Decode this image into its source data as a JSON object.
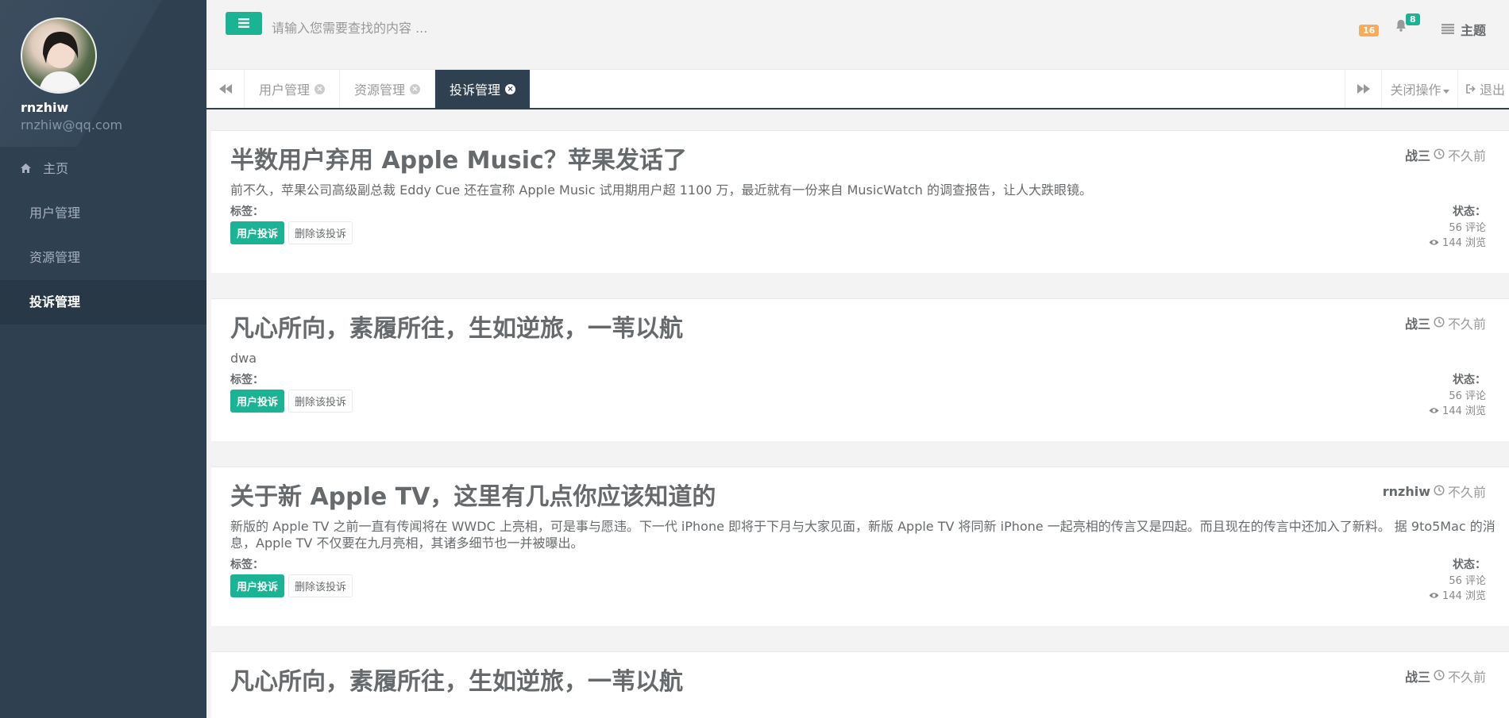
{
  "sidebar": {
    "profile": {
      "name": "rnzhiw",
      "email": "rnzhiw@qq.com"
    },
    "items": [
      {
        "label": "主页",
        "icon": "home-icon"
      },
      {
        "label": "用户管理"
      },
      {
        "label": "资源管理"
      },
      {
        "label": "投诉管理",
        "active": true
      }
    ]
  },
  "header": {
    "search_placeholder": "请输入您需要查找的内容 ...",
    "warning_badge": "16",
    "notification_badge": "8",
    "theme_label": "主题"
  },
  "tabs": [
    {
      "label": "用户管理"
    },
    {
      "label": "资源管理"
    },
    {
      "label": "投诉管理",
      "active": true
    }
  ],
  "tabbar": {
    "close_ops_label": "关闭操作",
    "logout_label": "退出"
  },
  "cards": [
    {
      "title": "半数用户弃用 Apple Music？苹果发话了",
      "description": "前不久，苹果公司高级副总裁 Eddy Cue 还在宣称 Apple Music 试用期用户超 1100 万，最近就有一份来自 MusicWatch 的调查报告，让人大跌眼镜。",
      "author": "战三",
      "time": "不久前",
      "tags_label": "标签：",
      "tag_primary": "用户投诉",
      "tag_delete": "删除该投诉",
      "status_label": "状态：",
      "comments": "56 评论",
      "views": "144 浏览"
    },
    {
      "title": "凡心所向，素履所往，生如逆旅，一苇以航",
      "description": "dwa",
      "author": "战三",
      "time": "不久前",
      "tags_label": "标签：",
      "tag_primary": "用户投诉",
      "tag_delete": "删除该投诉",
      "status_label": "状态：",
      "comments": "56 评论",
      "views": "144 浏览"
    },
    {
      "title": "关于新 Apple TV，这里有几点你应该知道的",
      "description": "新版的 Apple TV 之前一直有传闻将在 WWDC 上亮相，可是事与愿违。下一代 iPhone 即将于下月与大家见面，新版 Apple TV 将同新 iPhone 一起亮相的传言又是四起。而且现在的传言中还加入了新料。 据 9to5Mac 的消息，Apple TV 不仅要在九月亮相，其诸多细节也一并被曝出。",
      "author": "rnzhiw",
      "time": "不久前",
      "tags_label": "标签：",
      "tag_primary": "用户投诉",
      "tag_delete": "删除该投诉",
      "status_label": "状态：",
      "comments": "56 评论",
      "views": "144 浏览"
    },
    {
      "title": "凡心所向，素履所往，生如逆旅，一苇以航",
      "author": "战三",
      "time": "不久前"
    }
  ],
  "colors": {
    "primary": "#1ab394",
    "sidebar": "#2f4050",
    "warning": "#f8ac59"
  }
}
